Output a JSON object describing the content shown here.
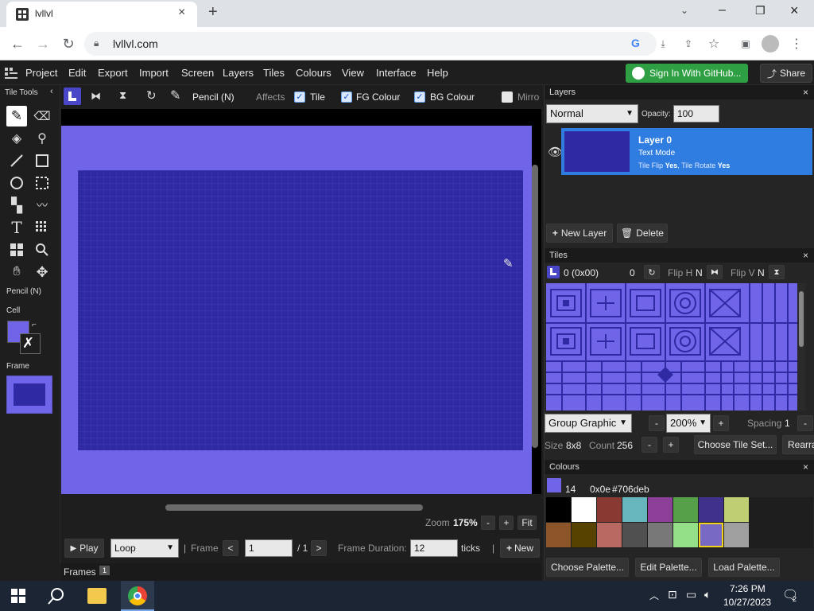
{
  "browser": {
    "tab_title": "lvllvl",
    "url": "lvllvl.com"
  },
  "menu": {
    "items": [
      "Project",
      "Edit",
      "Export",
      "Import",
      "Screen",
      "Layers",
      "Tiles",
      "Colours",
      "View",
      "Interface",
      "Help"
    ],
    "github_label": "Sign In With GitHub...",
    "share_label": "Share"
  },
  "toolbar": {
    "tool_name": "Pencil (N)",
    "affects_label": "Affects",
    "tile_label": "Tile",
    "fg_label": "FG Colour",
    "bg_label": "BG Colour",
    "mirror_label": "Mirro"
  },
  "left": {
    "title": "Tile Tools",
    "current_tool": "Pencil (N)",
    "cell_label": "Cell",
    "frame_label": "Frame"
  },
  "bottom": {
    "zoom_label": "Zoom",
    "zoom_value": "175%",
    "minus": "-",
    "plus": "+",
    "fit_label": "Fit",
    "play_label": "Play",
    "loop_value": "Loop",
    "sep": "|",
    "frame_label": "Frame",
    "prev": "<",
    "next": ">",
    "frame_value": "1",
    "frame_total": "/ 1",
    "duration_label": "Frame Duration:",
    "duration_value": "12",
    "ticks_label": "ticks",
    "new_label": "New",
    "frames_tab": "Frames",
    "frames_count": "1"
  },
  "layers": {
    "title": "Layers",
    "close": "×",
    "blend_mode": "Normal",
    "opacity_label": "Opacity:",
    "opacity_value": "100",
    "layer_name": "Layer 0",
    "layer_mode": "Text Mode",
    "tile_flip_label": "Tile Flip",
    "tile_flip_value": "Yes",
    "tile_rotate_label": "Tile Rotate",
    "tile_rotate_value": "Yes",
    "new_layer_label": "New Layer",
    "delete_label": "Delete"
  },
  "tiles": {
    "title": "Tiles",
    "close": "×",
    "tile_id": "0 (0x00)",
    "rotation": "0",
    "flip_h_label": "Flip H",
    "flip_h_value": "N",
    "flip_v_label": "Flip V",
    "flip_v_value": "N",
    "group_value": "Group Graphic",
    "minus": "-",
    "plus": "+",
    "zoom_value": "200%",
    "spacing_label": "Spacing",
    "spacing_value": "1",
    "size_label": "Size",
    "size_value": "8x8",
    "count_label": "Count",
    "count_value": "256",
    "choose_tileset_label": "Choose Tile Set...",
    "rearrange_label": "Rearra"
  },
  "colours": {
    "title": "Colours",
    "close": "×",
    "index": "14",
    "hex_index": "0x0e",
    "hex_color": "#706deb",
    "palette": [
      "#000000",
      "#ffffff",
      "#883932",
      "#67b6bd",
      "#8b3f96",
      "#55a049",
      "#40318d",
      "#bfce72",
      "#8b5429",
      "#574200",
      "#b86962",
      "#505050",
      "#787878",
      "#94e089",
      "#7869c4",
      "#9f9f9f"
    ],
    "selected_index": 14,
    "choose_palette_label": "Choose Palette...",
    "edit_palette_label": "Edit Palette...",
    "load_palette_label": "Load Palette..."
  },
  "taskbar": {
    "time": "7:26 PM",
    "date": "10/27/2023",
    "notif_count": "2"
  },
  "colors": {
    "accent_blue": "#2f7de1",
    "canvas_outer": "#7064e8",
    "canvas_inner": "#2f2aa3",
    "github_green": "#2ea043"
  }
}
